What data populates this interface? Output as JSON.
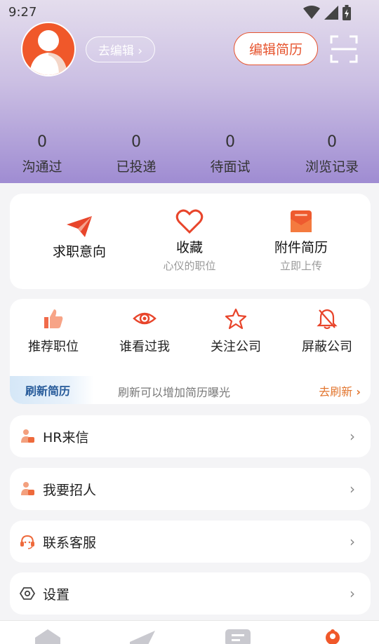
{
  "status_bar": {
    "time": "9:27"
  },
  "profile": {
    "edit_link": "去编辑 ›",
    "edit_resume_button": "编辑简历"
  },
  "stats": [
    {
      "value": "0",
      "label": "沟通过"
    },
    {
      "value": "0",
      "label": "已投递"
    },
    {
      "value": "0",
      "label": "待面试"
    },
    {
      "value": "0",
      "label": "浏览记录"
    }
  ],
  "quick_actions": [
    {
      "title": "求职意向",
      "subtitle": "",
      "icon": "paper-plane-icon"
    },
    {
      "title": "收藏",
      "subtitle": "心仪的职位",
      "icon": "heart-icon"
    },
    {
      "title": "附件简历",
      "subtitle": "立即上传",
      "icon": "envelope-icon"
    }
  ],
  "shortcuts": [
    {
      "label": "推荐职位",
      "icon": "thumbs-up-icon"
    },
    {
      "label": "谁看过我",
      "icon": "eye-icon"
    },
    {
      "label": "关注公司",
      "icon": "star-icon"
    },
    {
      "label": "屏蔽公司",
      "icon": "bell-off-icon"
    }
  ],
  "refresh": {
    "tag": "刷新简历",
    "description": "刷新可以增加简历曝光",
    "link": "去刷新"
  },
  "menu": [
    {
      "label": "HR来信",
      "icon": "hr-person-icon"
    },
    {
      "label": "我要招人",
      "icon": "recruit-person-icon"
    },
    {
      "label": "联系客服",
      "icon": "headset-icon"
    },
    {
      "label": "设置",
      "icon": "settings-icon"
    }
  ],
  "colors": {
    "accent": "#e6542e",
    "refresh_link": "#e2752e",
    "refresh_tag": "#275b9a"
  }
}
